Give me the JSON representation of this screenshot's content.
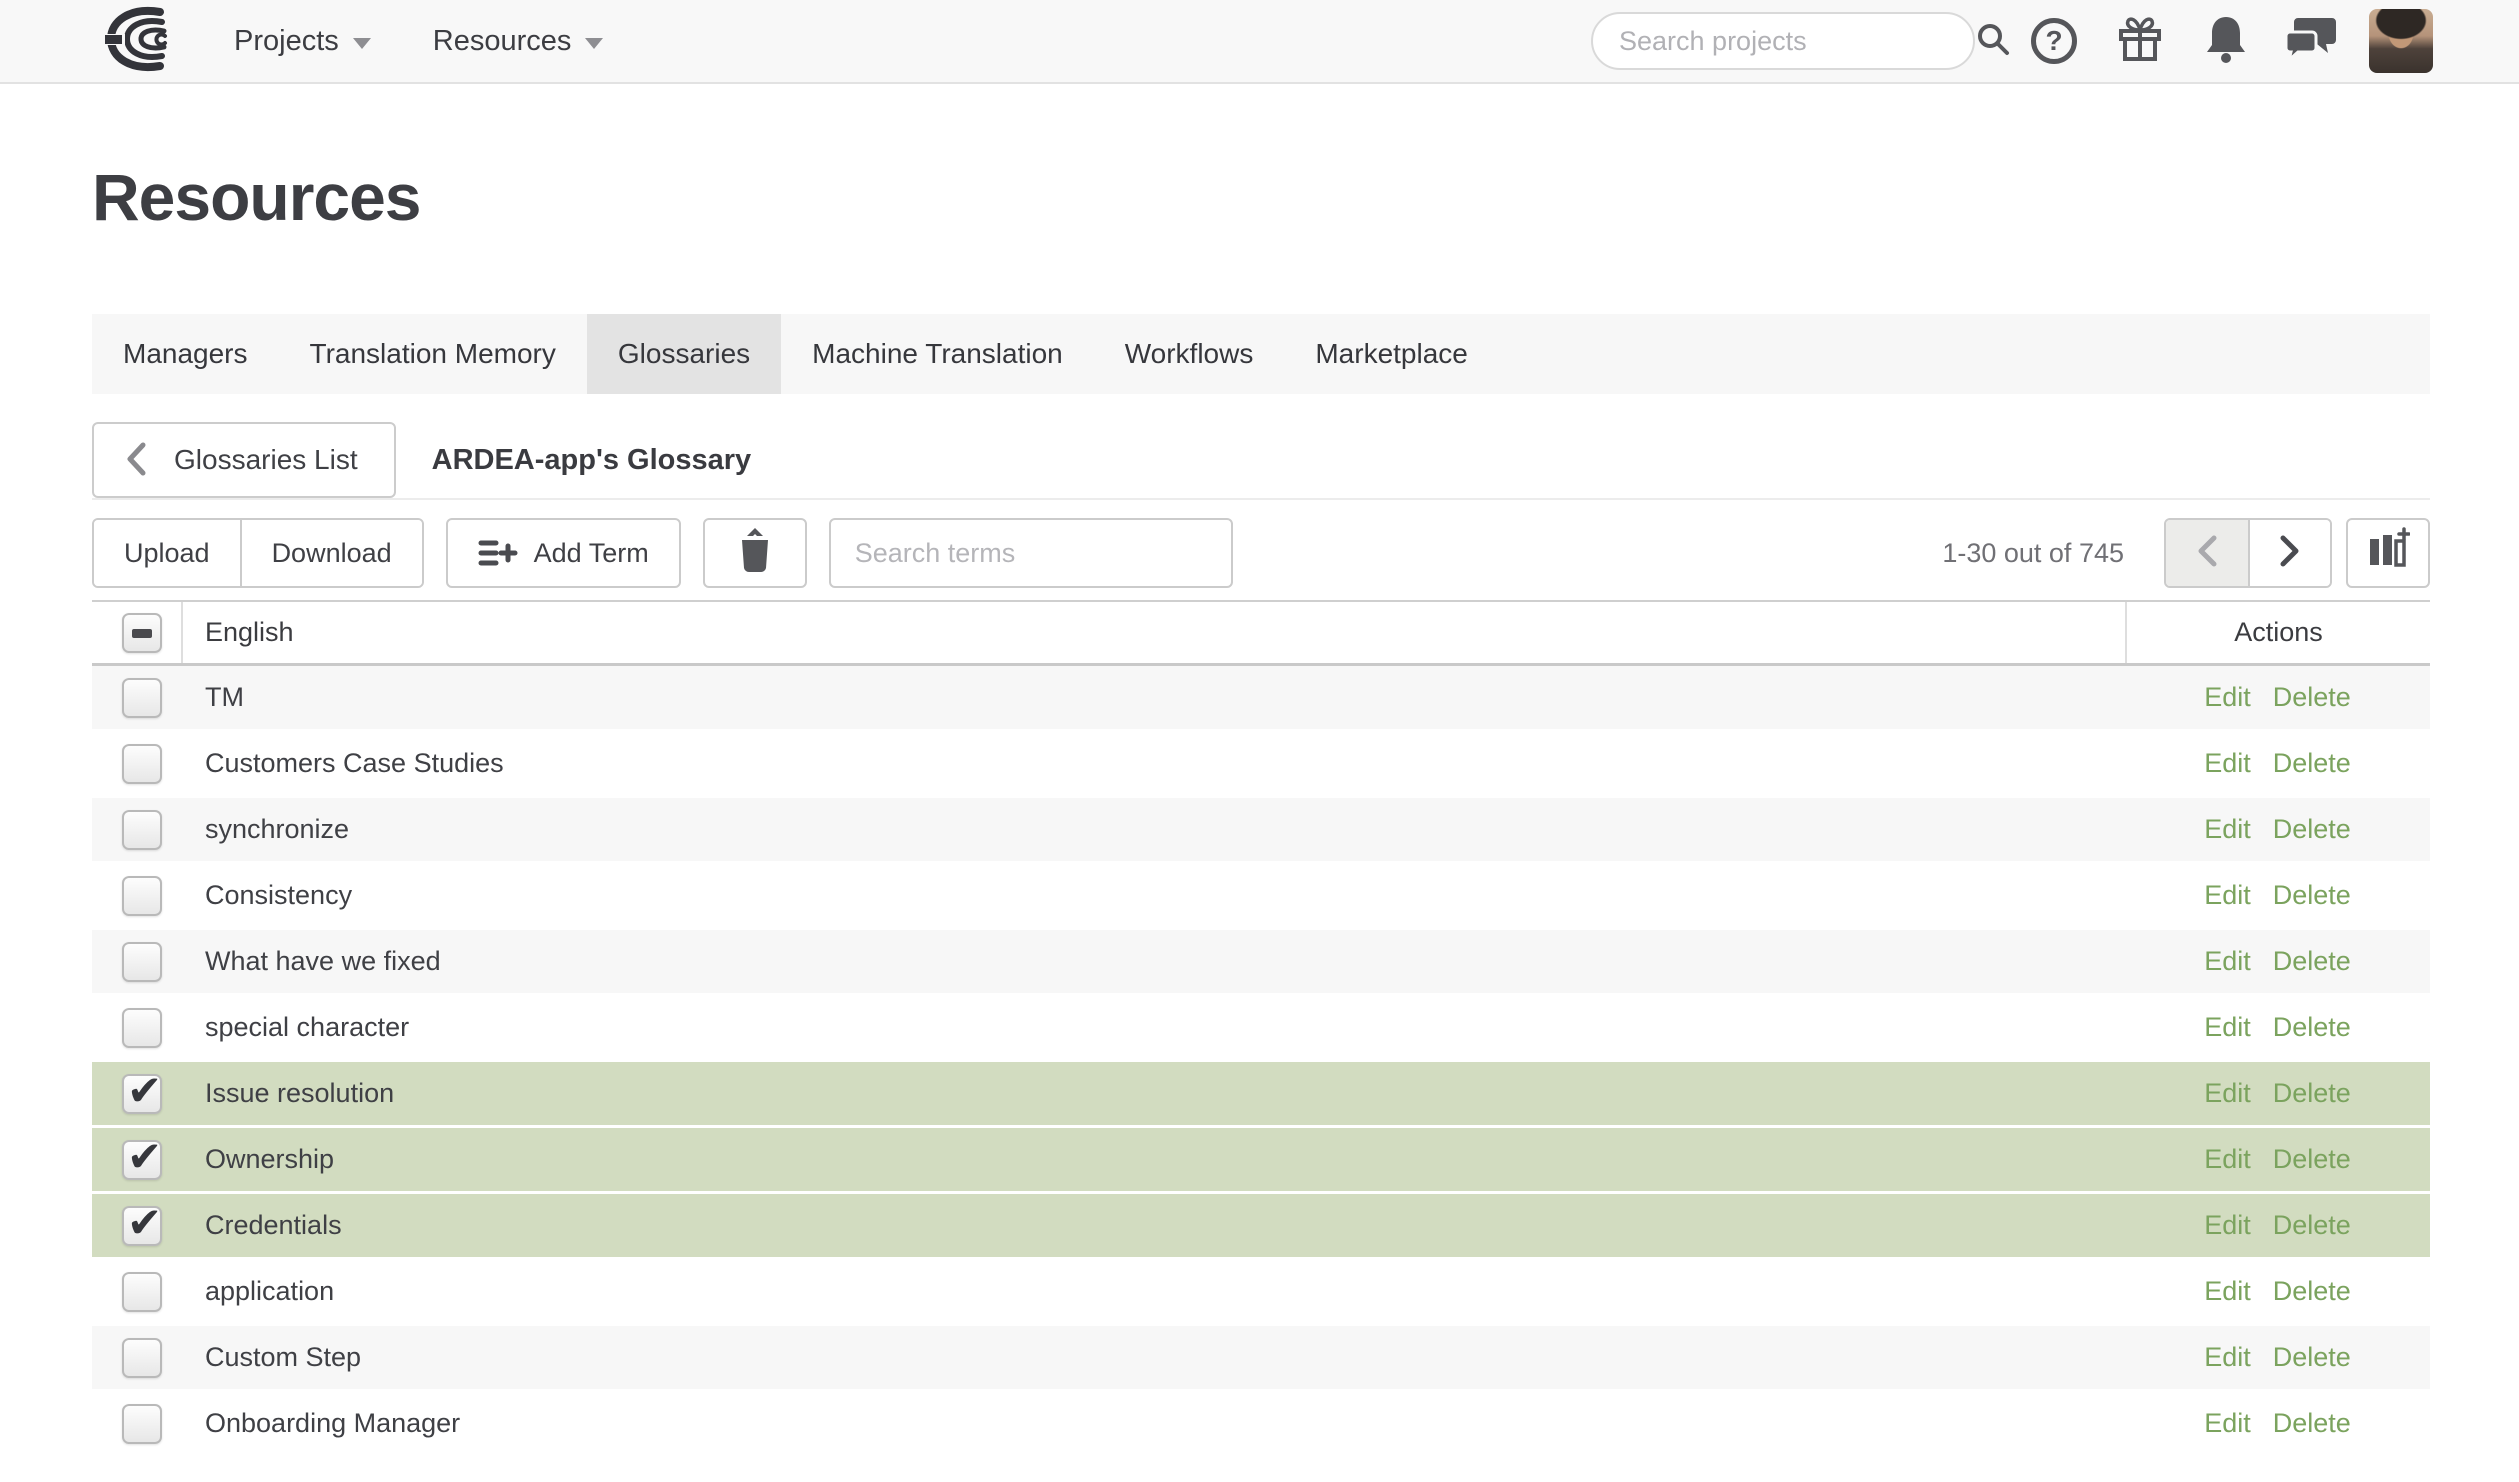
{
  "topnav": {
    "menus": [
      {
        "label": "Projects"
      },
      {
        "label": "Resources"
      }
    ],
    "search": {
      "placeholder": "Search projects"
    },
    "icons": {
      "brand": "swirl-logo",
      "search": "magnifier",
      "help": "question-circle",
      "gifts": "gift-box",
      "notifications": "bell",
      "messages": "chat-bubbles",
      "account": "avatar-photo"
    }
  },
  "page": {
    "title": "Resources"
  },
  "tabs": [
    {
      "label": "Managers",
      "active": false
    },
    {
      "label": "Translation Memory",
      "active": false
    },
    {
      "label": "Glossaries",
      "active": true
    },
    {
      "label": "Machine Translation",
      "active": false
    },
    {
      "label": "Workflows",
      "active": false
    },
    {
      "label": "Marketplace",
      "active": false
    }
  ],
  "breadcrumb": {
    "back_label": "Glossaries List",
    "current": "ARDEA-app's Glossary"
  },
  "toolbar": {
    "upload_label": "Upload",
    "download_label": "Download",
    "add_term_label": "Add Term",
    "delete_icon": "trash",
    "search_placeholder": "Search terms",
    "count_label": "1-30 out of 745",
    "prev_icon": "chevron-left",
    "next_icon": "chevron-right",
    "columns_icon": "columns-plus"
  },
  "table": {
    "columns": {
      "select": "select-all-checkbox",
      "term": "English",
      "actions": "Actions"
    },
    "select_all_state": "indeterminate",
    "actions": {
      "edit": "Edit",
      "delete": "Delete"
    },
    "rows": [
      {
        "term": "TM",
        "checked": false
      },
      {
        "term": "Customers Case Studies",
        "checked": false
      },
      {
        "term": "synchronize",
        "checked": false
      },
      {
        "term": "Consistency",
        "checked": false
      },
      {
        "term": "What have we fixed",
        "checked": false
      },
      {
        "term": "special character",
        "checked": false
      },
      {
        "term": "Issue resolution",
        "checked": true
      },
      {
        "term": "Ownership",
        "checked": true
      },
      {
        "term": "Credentials",
        "checked": true
      },
      {
        "term": "application",
        "checked": false
      },
      {
        "term": "Custom Step",
        "checked": false
      },
      {
        "term": "Onboarding Manager",
        "checked": false
      }
    ]
  },
  "colors": {
    "topbar_bg": "#f8f8f8",
    "tabbar_bg": "#f7f7f7",
    "active_tab_bg": "#e3e3e3",
    "row_stripe": "#f7f7f7",
    "row_selected": "#d2dcc0",
    "action_link_green": "#7ba35e",
    "icon_gray": "#55565a"
  }
}
